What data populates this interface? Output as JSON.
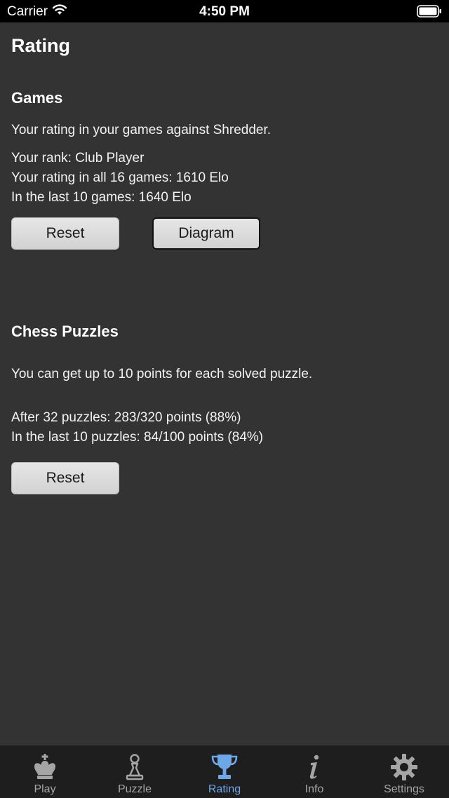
{
  "status": {
    "carrier": "Carrier",
    "time": "4:50 PM"
  },
  "page": {
    "title": "Rating"
  },
  "games": {
    "title": "Games",
    "description": "Your rating in your games against Shredder.",
    "rank": "Your rank: Club Player",
    "all_games": "Your rating in all 16 games: 1610 Elo",
    "last_games": "In the last 10 games: 1640 Elo",
    "reset_label": "Reset",
    "diagram_label": "Diagram"
  },
  "puzzles": {
    "title": "Chess Puzzles",
    "description": "You can get up to 10 points for each solved puzzle.",
    "after": "After 32 puzzles: 283/320 points (88%)",
    "last": "In the last 10 puzzles: 84/100 points (84%)",
    "reset_label": "Reset"
  },
  "tabs": [
    {
      "label": "Play",
      "icon": "king-icon"
    },
    {
      "label": "Puzzle",
      "icon": "pawn-icon"
    },
    {
      "label": "Rating",
      "icon": "trophy-icon",
      "active": true
    },
    {
      "label": "Info",
      "icon": "info-icon"
    },
    {
      "label": "Settings",
      "icon": "gear-icon"
    }
  ],
  "colors": {
    "background": "#333333",
    "tab_active": "#6ea7e8",
    "tab_inactive": "#a5a5a5"
  }
}
